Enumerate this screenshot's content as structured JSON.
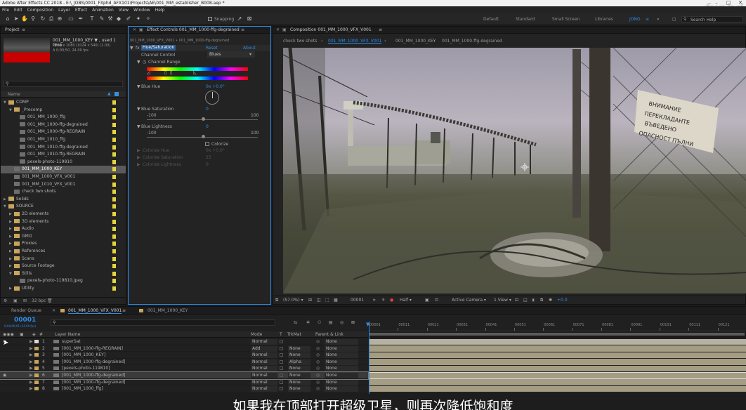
{
  "window": {
    "title": "Adobe After Effects CC 2018 - E:\\_JOBS\\0001_FXphd_AFX101\\Projects\\AE\\001_MM_establisher_B008.aep *",
    "watermark": "fxphd"
  },
  "menu": [
    "File",
    "Edit",
    "Composition",
    "Layer",
    "Effect",
    "Animation",
    "View",
    "Window",
    "Help"
  ],
  "toolbar": {
    "snapping_label": "Snapping",
    "workspaces": [
      "Default",
      "Standard",
      "Small Screen",
      "Libraries",
      "JONG"
    ],
    "search_placeholder": "Search Help"
  },
  "project": {
    "tab": "Project",
    "selected_name": "001_MM_1000_KEY ▼ , used 1 time",
    "info_lines": [
      "2048 x 1080 (1024 x 540) (1.00)",
      "Δ 0;00;50, 24.00 fps"
    ],
    "search_placeholder": "",
    "column_header": "Name",
    "items": [
      {
        "indent": 0,
        "twirl": "▼",
        "type": "folder",
        "name": "COMP"
      },
      {
        "indent": 1,
        "twirl": "▼",
        "type": "folder",
        "name": "_Precomp"
      },
      {
        "indent": 2,
        "twirl": "",
        "type": "comp",
        "name": "001_MM_1000_ffg"
      },
      {
        "indent": 2,
        "twirl": "",
        "type": "comp",
        "name": "001_MM_1000-ffg-degrained"
      },
      {
        "indent": 2,
        "twirl": "",
        "type": "comp",
        "name": "001_MM_1000-ffg-REGRAIN"
      },
      {
        "indent": 2,
        "twirl": "",
        "type": "comp",
        "name": "001_MM_1010_ffg"
      },
      {
        "indent": 2,
        "twirl": "",
        "type": "comp",
        "name": "001_MM_1010-ffg-degrained"
      },
      {
        "indent": 2,
        "twirl": "",
        "type": "comp",
        "name": "001_MM_1010-ffg-REGRAIN"
      },
      {
        "indent": 2,
        "twirl": "",
        "type": "comp",
        "name": "pexels-photo-119810"
      },
      {
        "indent": 1,
        "twirl": "",
        "type": "comp",
        "name": "001_MM_1000_KEY",
        "selected": true
      },
      {
        "indent": 1,
        "twirl": "",
        "type": "comp",
        "name": "001_MM_1000_VFX_V001"
      },
      {
        "indent": 1,
        "twirl": "",
        "type": "comp",
        "name": "001_MM_1010_VFX_V001"
      },
      {
        "indent": 1,
        "twirl": "",
        "type": "comp",
        "name": "check two shots"
      },
      {
        "indent": 0,
        "twirl": "▶",
        "type": "folder",
        "name": "Solids"
      },
      {
        "indent": 0,
        "twirl": "▼",
        "type": "folder",
        "name": "SOURCE"
      },
      {
        "indent": 1,
        "twirl": "▶",
        "type": "folder",
        "name": "2D elements"
      },
      {
        "indent": 1,
        "twirl": "▶",
        "type": "folder",
        "name": "3D elements"
      },
      {
        "indent": 1,
        "twirl": "▶",
        "type": "folder",
        "name": "Audio"
      },
      {
        "indent": 1,
        "twirl": "▶",
        "type": "folder",
        "name": "GMO"
      },
      {
        "indent": 1,
        "twirl": "▶",
        "type": "folder",
        "name": "Proxies"
      },
      {
        "indent": 1,
        "twirl": "▶",
        "type": "folder",
        "name": "References"
      },
      {
        "indent": 1,
        "twirl": "▶",
        "type": "folder",
        "name": "Scans"
      },
      {
        "indent": 1,
        "twirl": "▶",
        "type": "folder",
        "name": "Source Footage"
      },
      {
        "indent": 1,
        "twirl": "▼",
        "type": "folder",
        "name": "Stills"
      },
      {
        "indent": 2,
        "twirl": "",
        "type": "still",
        "name": "pexels-photo-119810.jpeg"
      },
      {
        "indent": 1,
        "twirl": "▶",
        "type": "folder",
        "name": "Utility"
      }
    ],
    "bpc": "32 bpc"
  },
  "effect_controls": {
    "tab": "Effect Controls 001_MM_1000-ffg-degrained",
    "path": "001_MM_1000_VFX_V001 • 001_MM_1000-ffg-degrained",
    "effect_name": "Hue/Saturation",
    "reset": "Reset",
    "about": "About",
    "channel_control_label": "Channel Control",
    "channel_control_value": "Blues",
    "channel_range_label": "Channel Range",
    "blue_hue_label": "Blue Hue",
    "blue_hue_value": "0x +0.0°",
    "blue_sat_label": "Blue Saturation",
    "blue_sat_value": "0",
    "blue_light_label": "Blue Lightness",
    "blue_light_value": "0",
    "range_min": "-100",
    "range_max": "100",
    "colorize_label": "Colorize",
    "colorize_hue": "Colorize Hue",
    "colorize_hue_value": "0x +0.0°",
    "colorize_sat": "Colorize Saturation",
    "colorize_sat_value": "25",
    "colorize_light": "Colorize Lightness",
    "colorize_light_value": "0"
  },
  "composition": {
    "tab": "Composition 001_MM_1000_VFX_V001",
    "breadcrumbs": [
      "check two shots",
      "001_MM_1000_VFX_V001",
      "001_MM_1000_KEY",
      "001_MM_1000-ffg-degrained"
    ],
    "sign_lines": [
      "ВНИМАНИЕ",
      "ПЕРЕКЛАДАНТЕ",
      "ВЪВЕДЕНО",
      "ОПАСНОСТ ПЪЛНИ"
    ],
    "footer": {
      "zoom": "(57.0%)",
      "time": "00001",
      "resolution": "Half",
      "camera": "Active Camera",
      "view": "1 View",
      "exposure": "+0.0"
    }
  },
  "timeline": {
    "tabs": [
      "Render Queue",
      "001_MM_1000_VFX_V001",
      "001_MM_1000_KEY"
    ],
    "timecode": "00001",
    "timecode_sub": "0;00;00;01 (24.00 fps)",
    "search_placeholder": "",
    "headers": {
      "layer": "Layer Name",
      "mode": "Mode",
      "t": "T",
      "trkmat": "TrkMat",
      "parent": "Parent & Link"
    },
    "ruler": [
      "00001",
      "00011",
      "00021",
      "00031",
      "00041",
      "00051",
      "00061",
      "00071",
      "00081",
      "00091",
      "00101",
      "00111",
      "00121"
    ],
    "layers": [
      {
        "num": "1",
        "name": "superSat",
        "mode": "Normal",
        "trkmat": "",
        "parent": "None",
        "color": "#d8d8d8",
        "bar": "#b7b1a4"
      },
      {
        "num": "2",
        "name": "[001_MM_1000-ffg-REGRAIN]",
        "mode": "Add",
        "trkmat": "None",
        "parent": "None",
        "color": "#c7a55a",
        "bar": "#a49c83"
      },
      {
        "num": "3",
        "name": "[001_MM_1000_KEY]",
        "mode": "Normal",
        "trkmat": "None",
        "parent": "None",
        "color": "#c7a55a",
        "bar": "#a49c83"
      },
      {
        "num": "4",
        "name": "[001_MM_1000-ffg-degrained]",
        "mode": "Normal",
        "trkmat": "Alpha",
        "parent": "None",
        "color": "#c7a55a",
        "bar": "#a49c83"
      },
      {
        "num": "5",
        "name": "[pexels-photo-119810]",
        "mode": "Normal",
        "trkmat": "None",
        "parent": "None",
        "color": "#c7a55a",
        "bar": "#a49c83"
      },
      {
        "num": "6",
        "name": "[001_MM_1000-ffg-degrained]",
        "mode": "Normal",
        "trkmat": "None",
        "parent": "None",
        "color": "#c7a55a",
        "bar": "#a49c83",
        "selected": true
      },
      {
        "num": "7",
        "name": "[001_MM_1000-ffg-degrained]",
        "mode": "Normal",
        "trkmat": "None",
        "parent": "None",
        "color": "#c7a55a",
        "bar": "#a49c83"
      },
      {
        "num": "8",
        "name": "[001_MM_1000_ffg]",
        "mode": "Normal",
        "trkmat": "None",
        "parent": "None",
        "color": "#c7a55a",
        "bar": "#a49c83"
      }
    ]
  },
  "subtitle": "如果我在顶部打开超级卫星，则再次降低饱和度",
  "colors": {
    "accent": "#2d8ceb",
    "label_yellow": "#e6d33c",
    "panel": "#232323"
  }
}
